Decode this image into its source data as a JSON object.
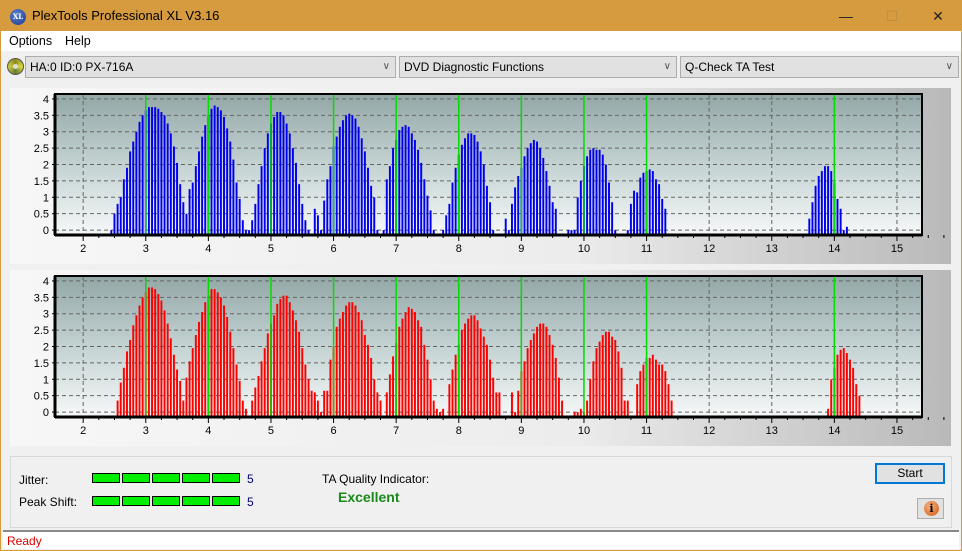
{
  "window": {
    "title": "PlexTools Professional XL V3.16",
    "app_icon_text": "XL",
    "minimize_glyph": "—",
    "maximize_glyph": "☐",
    "close_glyph": "✕"
  },
  "menu": {
    "items": [
      "Options",
      "Help"
    ]
  },
  "toolbar": {
    "drive_select": "HA:0 ID:0  PX-716A",
    "function_select": "DVD Diagnostic Functions",
    "test_select": "Q-Check TA Test",
    "chevron_glyph": "∨"
  },
  "results": {
    "jitter_label": "Jitter:",
    "jitter_value": "5",
    "jitter_level": 5,
    "jitter_max": 5,
    "peak_shift_label": "Peak Shift:",
    "peak_shift_value": "5",
    "peak_shift_level": 5,
    "peak_shift_max": 5,
    "ta_quality_label": "TA Quality Indicator:",
    "ta_quality_value": "Excellent",
    "meter_color": "#00ee00",
    "quality_color": "#1a8a1a"
  },
  "buttons": {
    "start": "Start",
    "info_glyph": "i"
  },
  "status": {
    "text": "Ready",
    "color": "#e00000"
  },
  "chart_data": [
    {
      "type": "bar",
      "name": "upper-ta-histogram",
      "title": "",
      "xlabel": "",
      "ylabel": "",
      "xlim": [
        1.55,
        15.4
      ],
      "ylim": [
        -0.15,
        4.15
      ],
      "x_ticks": [
        2,
        3,
        4,
        5,
        6,
        7,
        8,
        9,
        10,
        11,
        12,
        13,
        14,
        15
      ],
      "y_ticks": [
        0,
        0.5,
        1,
        1.5,
        2,
        2.5,
        3,
        3.5,
        4
      ],
      "y_tick_labels": [
        "0",
        "0.5",
        "1",
        "1.5",
        "2",
        "2.5",
        "3",
        "3.5",
        "4"
      ],
      "grid": true,
      "bar_color": "#0000ee",
      "reference_lines": [
        3,
        4,
        5,
        6,
        7,
        8,
        9,
        10,
        11,
        14
      ],
      "reference_color": "#00dd00",
      "bar_step": 0.05,
      "peaks": [
        {
          "start": 2.45,
          "values": [
            0,
            0.5,
            0.8,
            1.0,
            1.55,
            1.9,
            2.4,
            2.7,
            3.0,
            3.3,
            3.5,
            3.65,
            3.75,
            3.75,
            3.75,
            3.7,
            3.6,
            3.5,
            3.25,
            2.95,
            2.55,
            2.05,
            1.4,
            0.85,
            0.3,
            0
          ]
        },
        {
          "start": 3.65,
          "values": [
            0.5,
            1.25,
            1.45,
            1.95,
            2.4,
            2.85,
            3.2,
            3.5,
            3.7,
            3.8,
            3.75,
            3.65,
            3.45,
            3.1,
            2.7,
            2.15,
            1.45,
            0.95,
            0.3,
            0,
            0,
            0
          ]
        },
        {
          "start": 4.7,
          "values": [
            0.3,
            0.8,
            1.4,
            1.95,
            2.5,
            2.95,
            3.25,
            3.45,
            3.6,
            3.6,
            3.5,
            3.25,
            2.95,
            2.5,
            2.05,
            1.4,
            0.8,
            0.3,
            0
          ]
        },
        {
          "start": 5.7,
          "values": [
            0.65,
            0.45,
            0,
            0.9,
            1.55,
            1.95,
            2.55,
            2.85,
            3.15,
            3.35,
            3.5,
            3.55,
            3.5,
            3.4,
            3.15,
            2.8,
            2.4,
            1.9,
            1.35,
            1.0,
            0
          ]
        },
        {
          "start": 6.8,
          "values": [
            0,
            1.55,
            1.95,
            2.5,
            2.75,
            3.05,
            3.15,
            3.2,
            3.15,
            2.95,
            2.75,
            2.45,
            2.05,
            1.55,
            1.05,
            0.6,
            0
          ]
        },
        {
          "start": 7.75,
          "values": [
            0,
            0.45,
            0.8,
            1.45,
            1.9,
            2.3,
            2.6,
            2.8,
            2.95,
            2.95,
            2.9,
            2.7,
            2.4,
            2.0,
            1.35,
            0.85,
            0
          ]
        },
        {
          "start": 8.75,
          "values": [
            0.35,
            0,
            0.8,
            1.3,
            1.65,
            1.9,
            2.25,
            2.5,
            2.65,
            2.75,
            2.7,
            2.5,
            2.2,
            1.8,
            1.35,
            0.85,
            0.65
          ]
        },
        {
          "start": 9.75,
          "values": [
            0,
            0,
            0,
            1.0,
            1.5,
            1.95,
            2.25,
            2.45,
            2.5,
            2.45,
            2.45,
            2.3,
            2.0,
            1.45,
            0.85,
            0
          ]
        },
        {
          "start": 10.7,
          "values": [
            0,
            0.8,
            1.2,
            1.15,
            1.6,
            1.75,
            1.8,
            1.85,
            1.8,
            1.55,
            1.4,
            0.95,
            0.65
          ]
        },
        {
          "start": 13.6,
          "values": [
            0.35,
            0.85,
            1.35,
            1.65,
            1.8,
            1.95,
            1.95,
            1.8,
            1.45,
            0.95,
            0.65,
            0,
            0.1
          ]
        }
      ]
    },
    {
      "type": "bar",
      "name": "lower-ta-histogram",
      "title": "",
      "xlabel": "",
      "ylabel": "",
      "xlim": [
        1.55,
        15.4
      ],
      "ylim": [
        -0.15,
        4.15
      ],
      "x_ticks": [
        2,
        3,
        4,
        5,
        6,
        7,
        8,
        9,
        10,
        11,
        12,
        13,
        14,
        15
      ],
      "y_ticks": [
        0,
        0.5,
        1,
        1.5,
        2,
        2.5,
        3,
        3.5,
        4
      ],
      "y_tick_labels": [
        "0",
        "0.5",
        "1",
        "1.5",
        "2",
        "2.5",
        "3",
        "3.5",
        "4"
      ],
      "grid": true,
      "bar_color": "#ff0000",
      "reference_lines": [
        3,
        4,
        5,
        6,
        7,
        8,
        9,
        10,
        11,
        14
      ],
      "reference_color": "#00dd00",
      "bar_step": 0.05,
      "peaks": [
        {
          "start": 2.55,
          "values": [
            0.35,
            0.9,
            1.35,
            1.85,
            2.2,
            2.65,
            2.95,
            3.25,
            3.5,
            3.65,
            3.8,
            3.8,
            3.75,
            3.6,
            3.4,
            3.1,
            2.7,
            2.25,
            1.75,
            1.3,
            0.95,
            0.35,
            0
          ]
        },
        {
          "start": 3.65,
          "values": [
            1.05,
            1.55,
            1.95,
            2.35,
            2.75,
            3.05,
            3.35,
            3.55,
            3.75,
            3.75,
            3.65,
            3.5,
            3.25,
            2.9,
            2.45,
            1.95,
            1.45,
            0.95,
            0.35,
            0.1
          ]
        },
        {
          "start": 4.7,
          "values": [
            0.35,
            0.75,
            1.1,
            1.55,
            1.95,
            2.4,
            2.7,
            2.95,
            3.3,
            3.45,
            3.55,
            3.55,
            3.35,
            3.1,
            2.8,
            2.45,
            1.95,
            1.45,
            1.0,
            0.65,
            0.35
          ]
        },
        {
          "start": 5.7,
          "values": [
            0.6,
            0.35,
            0,
            0.65,
            0.65,
            1.6,
            2.0,
            2.6,
            2.85,
            3.05,
            3.25,
            3.35,
            3.35,
            3.25,
            3.05,
            2.8,
            2.35,
            2.05,
            1.65,
            1.0,
            0.6,
            0.35
          ]
        },
        {
          "start": 6.85,
          "values": [
            0.6,
            1.15,
            1.7,
            2.1,
            2.6,
            2.85,
            3.05,
            3.2,
            3.15,
            3.05,
            2.8,
            2.6,
            2.05,
            1.6,
            1.0,
            0.35,
            0.1,
            0,
            0.1
          ]
        },
        {
          "start": 7.85,
          "values": [
            0.85,
            1.3,
            1.75,
            2.05,
            2.5,
            2.7,
            2.85,
            2.95,
            2.95,
            2.8,
            2.55,
            2.3,
            2.05,
            1.6,
            1.05,
            0.6,
            0.6
          ]
        },
        {
          "start": 8.85,
          "values": [
            0.6,
            0,
            0.65,
            1.25,
            1.55,
            1.95,
            2.2,
            2.4,
            2.6,
            2.7,
            2.7,
            2.6,
            2.35,
            2.05,
            1.65,
            1.05,
            0.35
          ]
        },
        {
          "start": 9.85,
          "values": [
            0,
            0,
            0.1,
            0,
            0.35,
            1.0,
            1.55,
            1.95,
            2.15,
            2.35,
            2.45,
            2.45,
            2.3,
            2.2,
            1.85,
            1.35,
            0.35,
            0.35
          ]
        },
        {
          "start": 10.85,
          "values": [
            0.85,
            1.25,
            1.45,
            1.65,
            1.65,
            1.75,
            1.6,
            1.45,
            1.45,
            1.25,
            0.85,
            0.35
          ]
        },
        {
          "start": 13.9,
          "values": [
            0.1,
            1.0,
            1.35,
            1.75,
            1.9,
            1.95,
            1.8,
            1.6,
            1.35,
            0.85,
            0.5
          ]
        }
      ]
    }
  ]
}
